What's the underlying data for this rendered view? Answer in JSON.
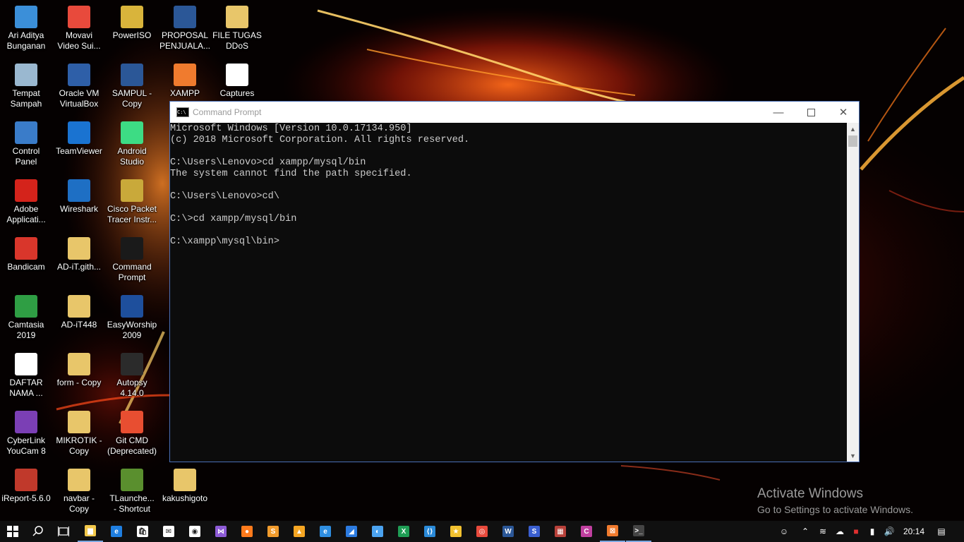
{
  "desktop": {
    "icons": [
      {
        "label": "Ari Aditya\nBunganan",
        "icon": "computer-icon",
        "color": "#3b8fd9"
      },
      {
        "label": "Movavi\nVideo Sui...",
        "icon": "movavi-icon",
        "color": "#e84a3c"
      },
      {
        "label": "PowerISO",
        "icon": "poweriso-icon",
        "color": "#d9b43b"
      },
      {
        "label": "PROPOSAL\nPENJUALA...",
        "icon": "word-document-icon",
        "color": "#2b5797"
      },
      {
        "label": "FILE TUGAS\nDDoS",
        "icon": "folder-icon",
        "color": "#e8c66a"
      },
      {
        "label": "Tempat\nSampah",
        "icon": "recycle-bin-icon",
        "color": "#9ab8d0"
      },
      {
        "label": "Oracle VM\nVirtualBox",
        "icon": "virtualbox-icon",
        "color": "#2e5fa8"
      },
      {
        "label": "SAMPUL -\nCopy",
        "icon": "word-document-icon",
        "color": "#2b5797"
      },
      {
        "label": "XAMPP",
        "icon": "xampp-icon",
        "color": "#f07b2e"
      },
      {
        "label": "Captures",
        "icon": "folder-white-icon",
        "color": "#ffffff"
      },
      {
        "label": "Control\nPanel",
        "icon": "control-panel-icon",
        "color": "#3a7cc9"
      },
      {
        "label": "TeamViewer",
        "icon": "teamviewer-icon",
        "color": "#1a73d1"
      },
      {
        "label": "Android\nStudio",
        "icon": "android-studio-icon",
        "color": "#3ddc84"
      },
      {
        "label": "Adobe\nApplicati...",
        "icon": "adobe-icon",
        "color": "#d4231b"
      },
      {
        "label": "Wireshark",
        "icon": "wireshark-icon",
        "color": "#1e6fc4"
      },
      {
        "label": "Cisco Packet\nTracer Instr...",
        "icon": "packet-tracer-icon",
        "color": "#c9a93a"
      },
      {
        "label": "Bandicam",
        "icon": "bandicam-icon",
        "color": "#d9362b"
      },
      {
        "label": "AD-iT.gith...",
        "icon": "file-icon",
        "color": "#e8c66a"
      },
      {
        "label": "Command\nPrompt",
        "icon": "command-prompt-icon",
        "color": "#1a1a1a"
      },
      {
        "label": "Camtasia\n2019",
        "icon": "camtasia-icon",
        "color": "#2f9e44"
      },
      {
        "label": "AD-iT448",
        "icon": "folder-icon",
        "color": "#e8c66a"
      },
      {
        "label": "EasyWorship\n2009",
        "icon": "easyworship-icon",
        "color": "#1e4f9c"
      },
      {
        "label": "DAFTAR\nNAMA ...",
        "icon": "document-icon",
        "color": "#ffffff"
      },
      {
        "label": "form - Copy",
        "icon": "file-icon",
        "color": "#e8c66a"
      },
      {
        "label": "Autopsy\n4.14.0",
        "icon": "autopsy-icon",
        "color": "#2b2b2b"
      },
      {
        "label": "CyberLink\nYouCam 8",
        "icon": "youcam-icon",
        "color": "#7b3fb5"
      },
      {
        "label": "MIKROTIK -\nCopy",
        "icon": "file-icon",
        "color": "#e8c66a"
      },
      {
        "label": "Git CMD\n(Deprecated)",
        "icon": "git-icon",
        "color": "#e84e31"
      },
      {
        "label": "iReport-5.6.0",
        "icon": "ireport-icon",
        "color": "#c0392b"
      },
      {
        "label": "navbar -\nCopy",
        "icon": "file-icon",
        "color": "#e8c66a"
      },
      {
        "label": "TLaunche...\n- Shortcut",
        "icon": "minecraft-icon",
        "color": "#5a8f2e"
      },
      {
        "label": "kakushigoto",
        "icon": "file-icon",
        "color": "#e8c66a"
      }
    ]
  },
  "watermark": {
    "title": "Activate Windows",
    "subtitle": "Go to Settings to activate Windows."
  },
  "cmd": {
    "title": "Command Prompt",
    "lines": [
      "Microsoft Windows [Version 10.0.17134.950]",
      "(c) 2018 Microsoft Corporation. All rights reserved.",
      "",
      "C:\\Users\\Lenovo>cd xampp/mysql/bin",
      "The system cannot find the path specified.",
      "",
      "C:\\Users\\Lenovo>cd\\",
      "",
      "C:\\>cd xampp/mysql/bin",
      "",
      "C:\\xampp\\mysql\\bin>"
    ]
  },
  "taskbar": {
    "apps": [
      {
        "name": "file-explorer-icon",
        "color": "#f3c94b",
        "glyph": "▆",
        "active": true
      },
      {
        "name": "edge-icon",
        "color": "#1f7fe0",
        "glyph": "e",
        "active": false
      },
      {
        "name": "store-icon",
        "color": "#ffffff",
        "glyph": "🛍",
        "active": false
      },
      {
        "name": "mail-icon",
        "color": "#ffffff",
        "glyph": "✉",
        "active": false
      },
      {
        "name": "camera-icon",
        "color": "#ffffff",
        "glyph": "◉",
        "active": false
      },
      {
        "name": "visual-studio-icon",
        "color": "#8d5bd6",
        "glyph": "⋈",
        "active": false
      },
      {
        "name": "firefox-icon",
        "color": "#ff7b1c",
        "glyph": "●",
        "active": false
      },
      {
        "name": "sublime-text-icon",
        "color": "#f09b2d",
        "glyph": "S",
        "active": false
      },
      {
        "name": "vlc-icon",
        "color": "#f5a623",
        "glyph": "▲",
        "active": false
      },
      {
        "name": "internet-explorer-icon",
        "color": "#2f8ee0",
        "glyph": "e",
        "active": false
      },
      {
        "name": "wireshark-icon",
        "color": "#2c7be0",
        "glyph": "◢",
        "active": false
      },
      {
        "name": "browser-icon",
        "color": "#4ba3f0",
        "glyph": "◐",
        "active": false
      },
      {
        "name": "excel-icon",
        "color": "#1f9d55",
        "glyph": "X",
        "active": false
      },
      {
        "name": "vscode-icon",
        "color": "#2a8ad8",
        "glyph": "⟨⟩",
        "active": false
      },
      {
        "name": "star-app-icon",
        "color": "#f2c230",
        "glyph": "★",
        "active": false
      },
      {
        "name": "chrome-icon",
        "color": "#e84a3c",
        "glyph": "◎",
        "active": false
      },
      {
        "name": "word-icon",
        "color": "#2b5797",
        "glyph": "W",
        "active": false
      },
      {
        "name": "streamlabs-icon",
        "color": "#3a5fd0",
        "glyph": "S",
        "active": false
      },
      {
        "name": "winrar-icon",
        "color": "#b8413a",
        "glyph": "▦",
        "active": false
      },
      {
        "name": "app-c-icon",
        "color": "#c040a0",
        "glyph": "C",
        "active": false
      },
      {
        "name": "xampp-icon",
        "color": "#f07b2e",
        "glyph": "⊠",
        "active": true
      },
      {
        "name": "command-prompt-icon",
        "color": "#444444",
        "glyph": ">_",
        "active": true
      }
    ],
    "clock": "20:14"
  }
}
